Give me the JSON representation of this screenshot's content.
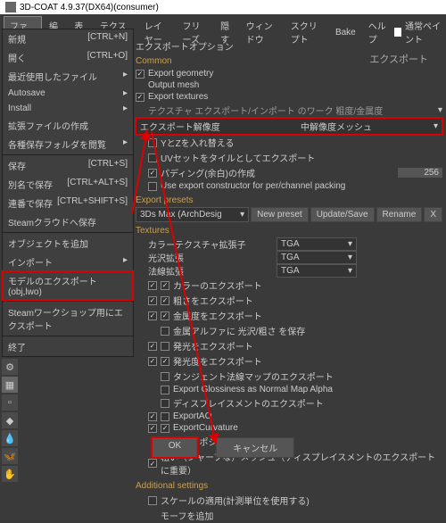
{
  "window": {
    "title": "3D-COAT 4.9.37(DX64)(consumer)"
  },
  "menubar": {
    "items": [
      "ファイル",
      "編集",
      "表示",
      "テクスチャ",
      "レイヤー",
      "フリーズ",
      "隠す",
      "ウィンドウ",
      "スクリプト",
      "Bake",
      "ヘルプ"
    ],
    "paint_label": "通常ペイント"
  },
  "export_title": "エクスポート",
  "file_menu": {
    "rows": [
      {
        "l": "新規",
        "s": "[CTRL+N]"
      },
      {
        "l": "開く",
        "s": "[CTRL+O]"
      },
      {
        "l": "最近使用したファイル",
        "s": "▸"
      },
      {
        "l": "Autosave",
        "s": "▸"
      },
      {
        "l": "Install",
        "s": "▸"
      },
      {
        "l": "拡張ファイルの作成",
        "s": ""
      },
      {
        "l": "各種保存フォルダを閲覧",
        "s": "▸"
      }
    ],
    "rows2": [
      {
        "l": "保存",
        "s": "[CTRL+S]"
      },
      {
        "l": "別名で保存",
        "s": "[CTRL+ALT+S]"
      },
      {
        "l": "連番で保存",
        "s": "[CTRL+SHIFT+S]"
      },
      {
        "l": "Steamクラウドへ保存",
        "s": ""
      }
    ],
    "rows3": [
      {
        "l": "オブジェクトを追加",
        "s": ""
      },
      {
        "l": "インポート",
        "s": "▸"
      },
      {
        "l": "モデルのエクスポート(obj,lwo)",
        "s": ""
      }
    ],
    "rows4": [
      {
        "l": "Steamワークショップ用にエクスポート",
        "s": ""
      }
    ],
    "rows5": [
      {
        "l": "終了",
        "s": ""
      }
    ]
  },
  "opts": {
    "title": "エクスポートオプション",
    "common": "Common",
    "export_geometry": "Export geometry",
    "output_mesh": "Output mesh",
    "export_textures": "Export textures",
    "tex_export_import": "テクスチャ エクスポート/インポート のワーク 粗度/金属度",
    "res_label": "エクスポート解像度",
    "res_value": "中解像度メッシュ",
    "swap_yz": "YとZを入れ替える",
    "uv_tile": "UVセットをタイルとしてエクスポート",
    "padding": "パディング(余白)の作成",
    "padding_val": "256",
    "use_constructor": "Use  export constructor  for  per/channel  packing",
    "presets": "Export presets",
    "preset_value": "3Ds Max (ArchDesig",
    "new_preset": "New preset",
    "update_save": "Update/Save",
    "rename": "Rename",
    "x": "X",
    "textures": "Textures",
    "color_ext": "カラーテクスチャ拡張子",
    "gloss_ext": "光沢拡張",
    "normal_ext": "法線拡張",
    "tga": "TGA",
    "color_exp": "カラーのエクスポート",
    "rough_exp": "粗さをエクスポート",
    "metal_exp": "金属度をエクスポート",
    "metal_alpha": "金属アルファに 光沢/粗さ を保存",
    "emit_exp": "発光をエクスポート",
    "emitdeg_exp": "発光度をエクスポート",
    "tangent_normal": "タンジェント法線マップのエクスポート",
    "gloss_normal": "Export Glossiness as Normal Map Alpha",
    "disp_exp": "ディスプレイスメントのエクスポート",
    "export_ao": "ExportAO",
    "export_curv": "ExportCurvature",
    "source_pos": "ソースポジションの使用",
    "rough_sharp": "粗い（シャープな）メッシュ（ディスプレイスメントのエクスポートに重要）",
    "addl": "Additional  settings",
    "scale_apply": "スケールの適用(計測単位を使用する)",
    "add_morph": "モーフを追加"
  },
  "footer": {
    "ok": "OK",
    "cancel": "キャンセル"
  }
}
